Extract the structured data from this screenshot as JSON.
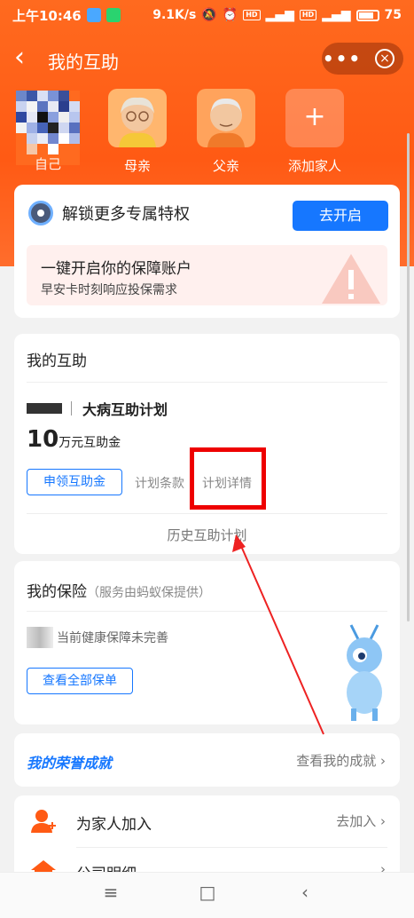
{
  "status_bar": {
    "time": "上午10:46",
    "speed": "9.1K/s",
    "battery": "75"
  },
  "nav": {
    "back": "‹",
    "title": "我的互助",
    "more": "•••",
    "close": "×"
  },
  "family": [
    {
      "label": "自己"
    },
    {
      "label": "母亲"
    },
    {
      "label": "父亲"
    },
    {
      "label": "添加家人",
      "plus": "+"
    }
  ],
  "unlock_card": {
    "title": "解锁更多专属特权",
    "button": "去开启",
    "promo_title": "一键开启你的保障账户",
    "promo_sub": "早安卡时刻响应投保需求"
  },
  "mutual": {
    "title": "我的互助",
    "plan_name": "大病互助计划",
    "amount": "10",
    "amount_unit": "万元互助金",
    "claim_button": "申领互助金",
    "terms_link": "计划条款",
    "detail_link": "计划详情",
    "history_link": "历史互助计划"
  },
  "insurance": {
    "title": "我的保险",
    "subtitle": "（服务由蚂蚁保提供）",
    "status_text": "当前健康保障未完善",
    "view_all": "查看全部保单"
  },
  "honor": {
    "title": "我的荣誉成就",
    "link": "查看我的成就 ›"
  },
  "actions": [
    {
      "label": "为家人加入",
      "right": "去加入 ›"
    },
    {
      "label": "公司明细",
      "right": "›"
    }
  ],
  "colors": {
    "brand_orange": "#ff5a14",
    "accent_blue": "#1677ff",
    "highlight_red": "#ee0000"
  },
  "system_nav": {
    "menu": "≡",
    "home": "□",
    "back": "‹"
  }
}
